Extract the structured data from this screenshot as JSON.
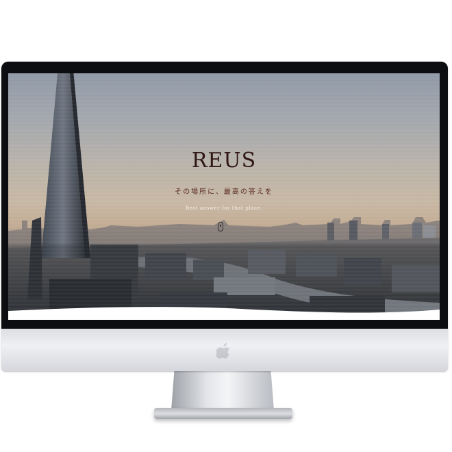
{
  "hero": {
    "logo": "REUS",
    "tagline_ja": "その場所に、最高の答えを",
    "tagline_en": "Best answer for that place."
  },
  "icons": {
    "scroll": "scroll-mouse-icon",
    "brand": "apple-logo-icon"
  },
  "colors": {
    "logo_text": "#2f1612",
    "tagline_ja": "#5a2a22",
    "tagline_en": "#f6efe8",
    "bezel": "#0c0d10",
    "chin": "#eef0f3"
  }
}
